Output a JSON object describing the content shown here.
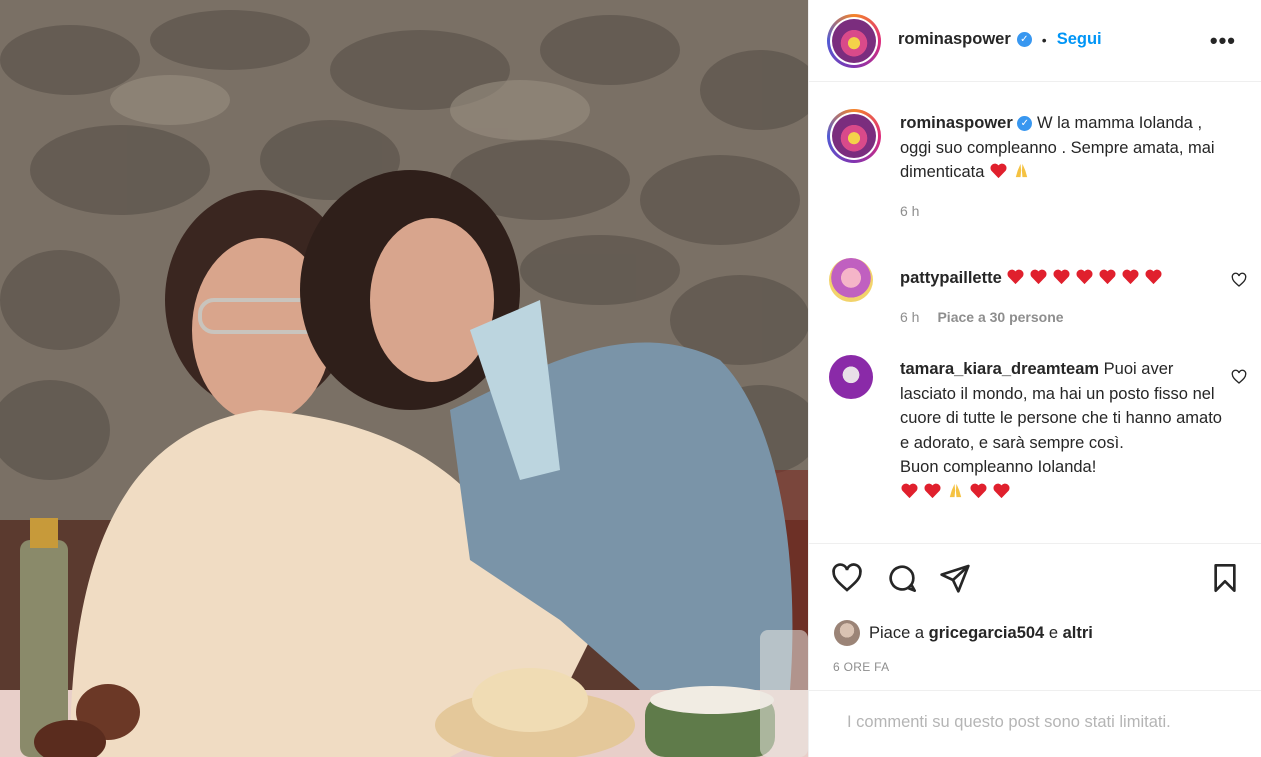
{
  "post": {
    "author": "rominaspower",
    "follow_label": "Segui",
    "separator": "•",
    "more_label": "•••",
    "verified_mark": "✓",
    "photo_description_icon": "photo-icon"
  },
  "caption": {
    "username": "rominaspower",
    "text": "W la mamma Iolanda , oggi suo compleanno . Sempre amata, mai dimenticata",
    "emojis": [
      "red-heart",
      "folded-hands"
    ],
    "time": "6 h"
  },
  "comments": [
    {
      "username": "pattypaillette",
      "text": "",
      "emojis": [
        "red-heart",
        "red-heart",
        "red-heart",
        "red-heart",
        "red-heart",
        "red-heart",
        "red-heart"
      ],
      "time": "6 h",
      "likes": "Piace a 30 persone"
    },
    {
      "username": "tamara_kiara_dreamteam",
      "text": "Puoi aver lasciato il mondo, ma hai un posto fisso nel cuore di tutte le persone che ti hanno amato e adorato, e sarà sempre così.",
      "text2": "Buon compleanno Iolanda!",
      "emojis": [
        "red-heart",
        "red-heart",
        "folded-hands",
        "red-heart",
        "red-heart"
      ]
    }
  ],
  "liked_by": {
    "prefix": "Piace a",
    "user": "gricegarcia504",
    "joiner": "e",
    "others": "altri"
  },
  "timestamp": "6 ORE FA",
  "restricted_notice": "I commenti su questo post sono stati limitati.",
  "colors": {
    "accent": "#0095f6",
    "text": "#262626",
    "muted": "#8e8e8e",
    "heart": "#e0202d"
  }
}
